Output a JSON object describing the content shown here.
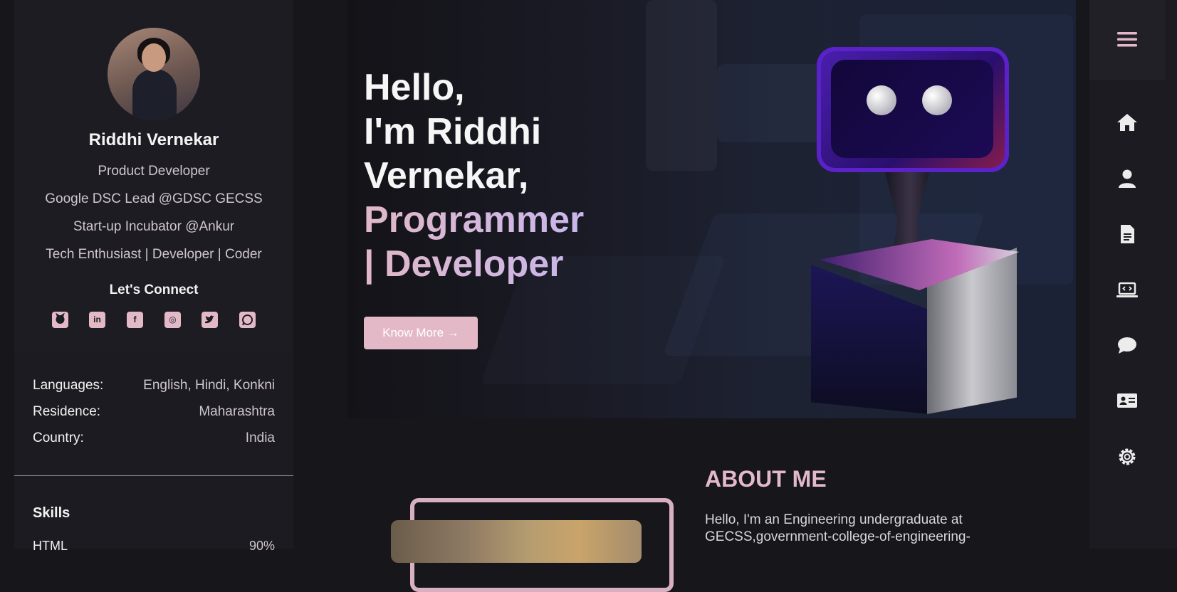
{
  "profile": {
    "name": "Riddhi Vernekar",
    "roles": [
      "Product Developer",
      "Google DSC Lead @GDSC GECSS",
      "Start-up Incubator @Ankur",
      "Tech Enthusiast | Developer | Coder"
    ],
    "connect_title": "Let's Connect",
    "socials": [
      {
        "icon": "github-icon"
      },
      {
        "icon": "linkedin-icon",
        "glyph": "in"
      },
      {
        "icon": "facebook-icon",
        "glyph": "f"
      },
      {
        "icon": "instagram-icon",
        "glyph": "◎"
      },
      {
        "icon": "twitter-icon"
      },
      {
        "icon": "whatsapp-icon"
      }
    ]
  },
  "info": [
    {
      "label": "Languages:",
      "value": "English, Hindi, Konkni"
    },
    {
      "label": "Residence:",
      "value": "Maharashtra"
    },
    {
      "label": "Country:",
      "value": "India"
    }
  ],
  "skills": {
    "title": "Skills",
    "first": {
      "label": "HTML",
      "value": "90%"
    }
  },
  "hero": {
    "lines": [
      "Hello,",
      "I'm Riddhi",
      "Vernekar,"
    ],
    "accent_lines": [
      "Programmer",
      "| Developer"
    ],
    "button": "Know More →"
  },
  "about": {
    "title": "ABOUT ME",
    "text": "Hello, I'm an Engineering undergraduate at GECSS,government-college-of-engineering-"
  },
  "nav": [
    "menu-icon",
    "home-icon",
    "user-icon",
    "document-icon",
    "laptop-code-icon",
    "chat-icon",
    "contact-card-icon",
    "settings-icon"
  ],
  "colors": {
    "accent": "#e3b9c8",
    "accent2": "#c9b6ec",
    "background": "#16161b",
    "sidebar": "#1b1b21"
  }
}
